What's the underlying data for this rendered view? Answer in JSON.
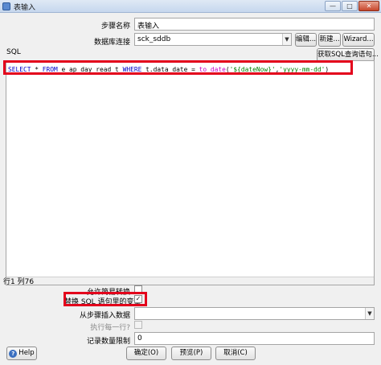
{
  "window": {
    "title": "表输入",
    "minimize_glyph": "—",
    "maximize_glyph": "□",
    "close_glyph": "✕"
  },
  "form": {
    "step_name_label": "步骤名称",
    "step_name_value": "表输入",
    "db_connection_label": "数据库连接",
    "db_connection_value": "sck_sddb",
    "edit_button": "编辑...",
    "new_button": "新建...",
    "wizard_button": "Wizard...",
    "sql_label": "SQL",
    "get_sql_button": "获取SQL查询语句...",
    "sql_tokens": [
      {
        "text": "SELECT",
        "kind": "kw"
      },
      {
        "text": " * ",
        "kind": "txt"
      },
      {
        "text": "FROM",
        "kind": "kw"
      },
      {
        "text": " e_ap_day_read t ",
        "kind": "txt"
      },
      {
        "text": "WHERE",
        "kind": "kw"
      },
      {
        "text": " t.data_date = ",
        "kind": "txt"
      },
      {
        "text": "to_date",
        "kind": "fn"
      },
      {
        "text": "(",
        "kind": "txt"
      },
      {
        "text": "'${dateNow}'",
        "kind": "str"
      },
      {
        "text": ",",
        "kind": "txt"
      },
      {
        "text": "'yyyy-mm-dd'",
        "kind": "str"
      },
      {
        "text": ")",
        "kind": "txt"
      }
    ],
    "cursor_position": "行1 列76",
    "lazy_conversion_label": "允许简易转换",
    "lazy_conversion_checked": false,
    "replace_variables_label": "替换 SQL 语句里的变量",
    "replace_variables_checked": true,
    "insert_from_step_label": "从步骤插入数据",
    "insert_from_step_value": "",
    "execute_each_row_label": "执行每一行?",
    "execute_each_row_checked": false,
    "limit_label": "记录数量限制",
    "limit_value": "0"
  },
  "footer": {
    "help_button": "Help",
    "help_icon_glyph": "?",
    "ok_button": "确定(O)",
    "preview_button": "预览(P)",
    "cancel_button": "取消(C)"
  },
  "colors": {
    "highlight": "#e3001b",
    "sql_keyword": "#0000c8",
    "sql_function": "#c800c8",
    "sql_string": "#008000"
  }
}
